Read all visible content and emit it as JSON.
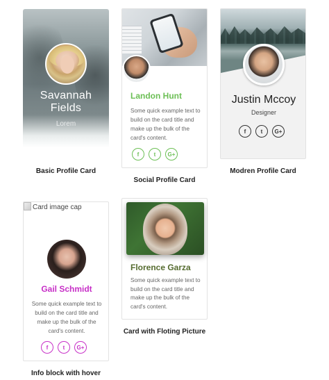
{
  "cards": {
    "basic": {
      "name_line1": "Savannah",
      "name_line2": "Fields",
      "subtitle": "Lorem",
      "caption": "Basic Profile Card"
    },
    "social": {
      "name": "Landon Hunt",
      "text": "Some quick example text to build on the card title and make up the bulk of the card's content.",
      "caption": "Social Profile Card",
      "accent": "#6cbf55",
      "icons": [
        "f",
        "t",
        "G+"
      ]
    },
    "modern": {
      "name": "Justin Mccoy",
      "role": "Designer",
      "caption": "Modren Profile Card",
      "icons": [
        "f",
        "t",
        "G+"
      ]
    },
    "info": {
      "broken_image_alt": "Card image cap",
      "name": "Gail Schmidt",
      "text": "Some quick example text to build on the card title and make up the bulk of the card's content.",
      "caption": "Info block with hover",
      "accent": "#c72fc7",
      "icons": [
        "f",
        "t",
        "G+"
      ]
    },
    "floating": {
      "name": "Florence Garza",
      "text": "Some quick example text to build on the card title and make up the bulk of the card's content.",
      "caption": "Card with Floting Picture",
      "accent": "#556b2f"
    }
  }
}
